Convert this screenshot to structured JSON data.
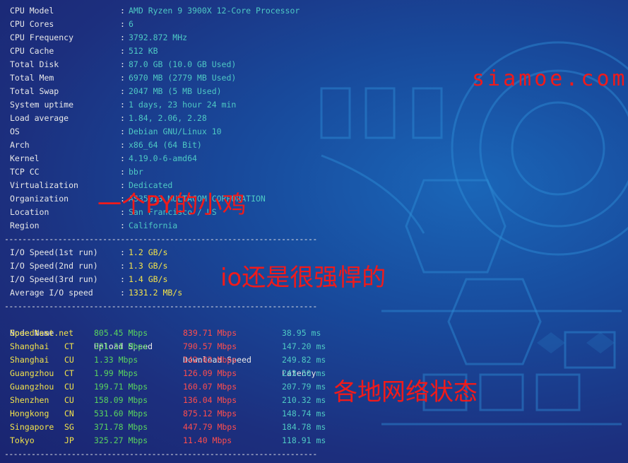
{
  "sysinfo": [
    {
      "label": "CPU Model",
      "value": "AMD Ryzen 9 3900X 12-Core Processor"
    },
    {
      "label": "CPU Cores",
      "value": "6"
    },
    {
      "label": "CPU Frequency",
      "value": "3792.872 MHz"
    },
    {
      "label": "CPU Cache",
      "value": "512 KB"
    },
    {
      "label": "Total Disk",
      "value": "87.0 GB (10.0 GB Used)"
    },
    {
      "label": "Total Mem",
      "value": "6970 MB (2779 MB Used)"
    },
    {
      "label": "Total Swap",
      "value": "2047 MB (5 MB Used)"
    },
    {
      "label": "System uptime",
      "value": "1 days, 23 hour 24 min"
    },
    {
      "label": "Load average",
      "value": "1.84, 2.06, 2.28"
    },
    {
      "label": "OS",
      "value": "Debian GNU/Linux 10"
    },
    {
      "label": "Arch",
      "value": "x86_64 (64 Bit)"
    },
    {
      "label": "Kernel",
      "value": "4.19.0-6-amd64"
    },
    {
      "label": "TCP CC",
      "value": "bbr"
    },
    {
      "label": "Virtualization",
      "value": "Dedicated"
    },
    {
      "label": "Organization",
      "value": "AS35913 MULTACOM CORPORATION"
    },
    {
      "label": "Location",
      "value": "San Francisco / US"
    },
    {
      "label": "Region",
      "value": "California"
    }
  ],
  "separator": "----------------------------------------------------------------------",
  "colon": ":",
  "io": [
    {
      "label": "I/O Speed(1st run)",
      "value": "1.2 GB/s"
    },
    {
      "label": "I/O Speed(2nd run)",
      "value": "1.3 GB/s"
    },
    {
      "label": "I/O Speed(3rd run)",
      "value": "1.4 GB/s"
    },
    {
      "label": "Average I/O speed",
      "value": "1331.2 MB/s"
    }
  ],
  "speed_headers": {
    "node": "Node Name",
    "upload": "Upload Speed",
    "download": "Download Speed",
    "latency": "Latency"
  },
  "speedtests": [
    {
      "node": "Speedtest.net",
      "isp": "",
      "up": "805.45 Mbps",
      "down": "839.71 Mbps",
      "lat": "38.95 ms"
    },
    {
      "node": "Shanghai",
      "isp": "CT",
      "up": "331.31 Mbps",
      "down": "790.57 Mbps",
      "lat": "147.20 ms"
    },
    {
      "node": "Shanghai",
      "isp": "CU",
      "up": "1.33 Mbps",
      "down": "142.02 Mbps",
      "lat": "249.82 ms"
    },
    {
      "node": "Guangzhou",
      "isp": "CT",
      "up": "1.99 Mbps",
      "down": "126.09 Mbps",
      "lat": "243.50 ms"
    },
    {
      "node": "Guangzhou",
      "isp": "CU",
      "up": "199.71 Mbps",
      "down": "160.07 Mbps",
      "lat": "207.79 ms"
    },
    {
      "node": "Shenzhen",
      "isp": "CU",
      "up": "158.09 Mbps",
      "down": "136.04 Mbps",
      "lat": "210.32 ms"
    },
    {
      "node": "Hongkong",
      "isp": "CN",
      "up": "531.60 Mbps",
      "down": "875.12 Mbps",
      "lat": "148.74 ms"
    },
    {
      "node": "Singapore",
      "isp": "SG",
      "up": "371.78 Mbps",
      "down": "447.79 Mbps",
      "lat": "184.78 ms"
    },
    {
      "node": "Tokyo",
      "isp": "JP",
      "up": "325.27 Mbps",
      "down": "11.40 Mbps",
      "lat": "118.91 ms"
    }
  ],
  "overlays": {
    "watermark": "siamoe.com",
    "note1": "一个PY的小鸡",
    "note2": "io还是很强悍的",
    "note3": "各地网络状态"
  },
  "colors": {
    "label": "#e8e8e8",
    "value": "#4ec9c4",
    "io": "#f2e34a",
    "upload": "#59d35e",
    "download": "#ff4d4d",
    "overlay": "#f11a1a"
  }
}
